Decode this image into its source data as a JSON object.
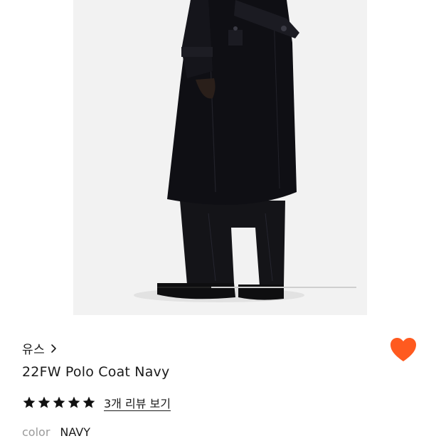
{
  "brand": {
    "name": "유스",
    "chevron_icon": "chevron-right-icon"
  },
  "product": {
    "title": "22FW Polo Coat Navy"
  },
  "rating": {
    "stars": 5,
    "star_color": "#111111",
    "review_link": "3개 리뷰 보기"
  },
  "option": {
    "label": "color",
    "value": "NAVY"
  },
  "wishlist": {
    "icon": "heart-icon",
    "color": "#ff5a1f",
    "active": true
  },
  "image": {
    "alt_icon": "product-photo",
    "progress": 0.27
  }
}
